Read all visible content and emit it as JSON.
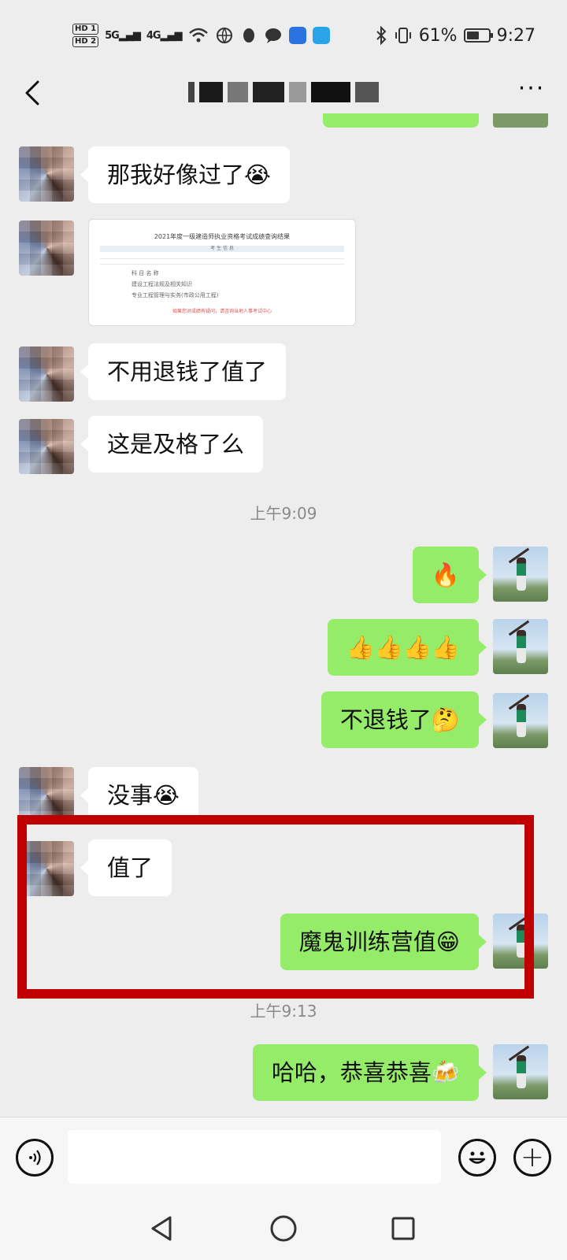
{
  "status_bar": {
    "hd1": "HD 1",
    "hd2": "HD 2",
    "signal1": "5G",
    "signal2": "4G",
    "battery_pct": "61%",
    "battery_level": 0.61,
    "time": "9:27"
  },
  "header": {
    "more_label": "···"
  },
  "messages": {
    "m1": "那我好像过了😭",
    "m3": "不用退钱了值了",
    "m4": "这是及格了么",
    "ts1": "上午9:09",
    "m5": "🔥",
    "m6": "👍👍👍👍",
    "m7": "不退钱了🤔",
    "m8": "没事😭",
    "m9": "值了",
    "m10": "魔鬼训练营值😁",
    "ts2": "上午9:13",
    "m11": "哈哈，恭喜恭喜🍻"
  },
  "image_msg": {
    "title": "2021年度一级建造师执业资格考试成绩查询结果",
    "section1": "考 生 信 息",
    "section2": "科 目 名 称",
    "row1": "建设工程法规及相关知识",
    "row2": "专业工程管理与实务(市政公用工程)",
    "foot": "如果您对成绩有疑问，请咨询当地人事考试中心"
  },
  "input_bar": {
    "plus_label": "+"
  },
  "colors": {
    "sent_bubble": "#95ec69",
    "received_bubble": "#ffffff",
    "highlight": "#c00000",
    "background": "#ededed"
  }
}
